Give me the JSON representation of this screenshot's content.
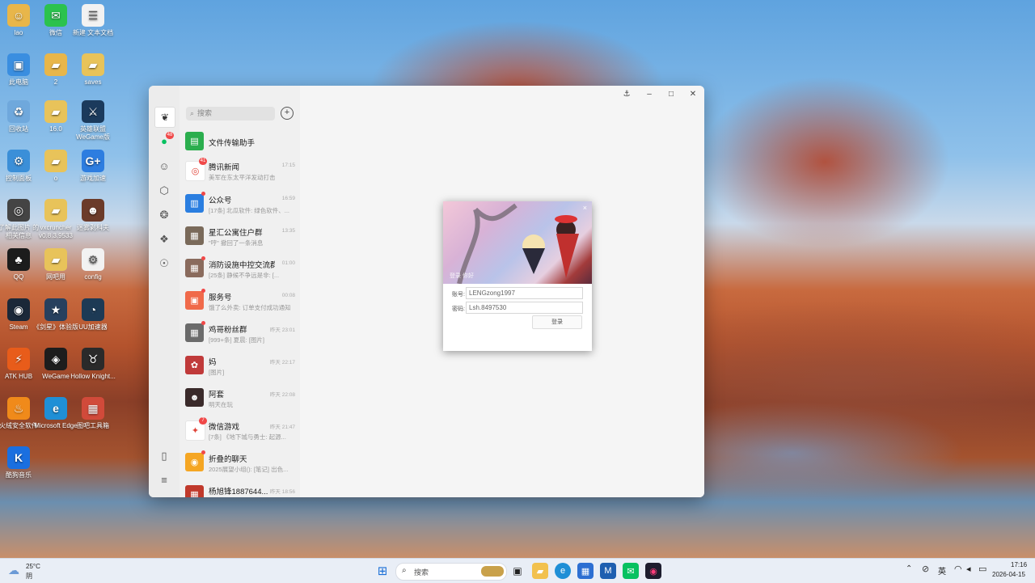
{
  "desktop": {
    "icons": [
      {
        "label": "lao",
        "glyph": "☺",
        "color": "#e8b64a"
      },
      {
        "label": "微信",
        "glyph": "✉",
        "color": "#2bc24e"
      },
      {
        "label": "新建 文本文档",
        "glyph": "☰",
        "color": "#f2f2f2"
      },
      {
        "label": "此电脑",
        "glyph": "▣",
        "color": "#3a8ee0"
      },
      {
        "label": "2",
        "glyph": "▰",
        "color": "#e8b64a"
      },
      {
        "label": "saves",
        "glyph": "▰",
        "color": "#e8c35a"
      },
      {
        "label": "回收站",
        "glyph": "♻",
        "color": "#6fa8dc"
      },
      {
        "label": "16.0",
        "glyph": "▰",
        "color": "#e8c35a"
      },
      {
        "label": "英雄联盟 WeGame版",
        "glyph": "⚔",
        "color": "#1b3a5c"
      },
      {
        "label": "控制面板",
        "glyph": "⚙",
        "color": "#3b8fd8"
      },
      {
        "label": "o",
        "glyph": "▰",
        "color": "#e8c35a"
      },
      {
        "label": "游戏加速",
        "glyph": "G+",
        "color": "#2d7de0"
      },
      {
        "label": "了解此图片 的相关信息",
        "glyph": "◎",
        "color": "#444"
      },
      {
        "label": "vxcruncher v0.8.3.9533",
        "glyph": "▰",
        "color": "#e8c35a"
      },
      {
        "label": "迷雾剥科夫",
        "glyph": "☻",
        "color": "#6b3b2a"
      },
      {
        "label": "QQ",
        "glyph": "♣",
        "color": "#1c1c1c"
      },
      {
        "label": "网吧用",
        "glyph": "▰",
        "color": "#e8c35a"
      },
      {
        "label": "config",
        "glyph": "⚙",
        "color": "#f2f2f2"
      },
      {
        "label": "Steam",
        "glyph": "◉",
        "color": "#1b2838"
      },
      {
        "label": "《剑星》体验版",
        "glyph": "★",
        "color": "#27405e"
      },
      {
        "label": "UU加速器",
        "glyph": "◔",
        "color": "#1d3a55"
      },
      {
        "label": "ATK HUB",
        "glyph": "⚡",
        "color": "#e85c1a"
      },
      {
        "label": "WeGame",
        "glyph": "◈",
        "color": "#1d1d1d"
      },
      {
        "label": "Hollow Knight...",
        "glyph": "♉",
        "color": "#2a2a2a"
      },
      {
        "label": "火绒安全软件",
        "glyph": "♨",
        "color": "#f08a1a"
      },
      {
        "label": "Microsoft Edge",
        "glyph": "e",
        "color": "#1f8fd6"
      },
      {
        "label": "图吧工具箱",
        "glyph": "▦",
        "color": "#d14a3a"
      },
      {
        "label": "酷狗音乐",
        "glyph": "K",
        "color": "#1a6fe0"
      }
    ]
  },
  "wechat": {
    "search_placeholder": "搜索",
    "plus_glyph": "+",
    "sidebar_badge": "48",
    "chats": [
      {
        "name": "文件传输助手",
        "preview": "",
        "time": "",
        "avatar_color": "#2bae4e",
        "glyph": "▤",
        "badge": "",
        "dot": false
      },
      {
        "name": "腾讯新闻",
        "preview": "美军在东太平洋发动打击",
        "time": "17:15",
        "avatar_color": "#ffffff",
        "glyph": "◎",
        "badge": "41",
        "dot": false
      },
      {
        "name": "公众号",
        "preview": "[17条] 北瓜软件: 绿色软件、...",
        "time": "16:59",
        "avatar_color": "#2a7ee0",
        "glyph": "▥",
        "badge": "",
        "dot": true
      },
      {
        "name": "星汇公寓住户群",
        "preview": "\"哼\" 撤回了一条消息",
        "time": "13:35",
        "avatar_color": "#7a6a5a",
        "glyph": "▦",
        "badge": "",
        "dot": false
      },
      {
        "name": "消防设施中控交流群",
        "preview": "[25条] 静候不争远是非: [...",
        "time": "01:00",
        "avatar_color": "#8a6b5d",
        "glyph": "▦",
        "badge": "",
        "dot": true
      },
      {
        "name": "服务号",
        "preview": "饿了么外卖: 订单支付成功通知",
        "time": "00:08",
        "avatar_color": "#f06a4a",
        "glyph": "▣",
        "badge": "",
        "dot": true
      },
      {
        "name": "鸡哥粉丝群",
        "preview": "[999+条] 夏晨: [图片]",
        "time": "昨天 23:01",
        "avatar_color": "#6b6b6b",
        "glyph": "▦",
        "badge": "",
        "dot": true
      },
      {
        "name": "妈",
        "preview": "[图片]",
        "time": "昨天 22:17",
        "avatar_color": "#c03a3a",
        "glyph": "✿",
        "badge": "",
        "dot": false
      },
      {
        "name": "阿套",
        "preview": "明天在玩",
        "time": "昨天 22:08",
        "avatar_color": "#3a2a2a",
        "glyph": "☻",
        "badge": "",
        "dot": false
      },
      {
        "name": "微信游戏",
        "preview": "[7条] 《地下城与勇士: 起源...",
        "time": "昨天 21:47",
        "avatar_color": "#ffffff",
        "glyph": "✦",
        "badge": "7",
        "dot": false
      },
      {
        "name": "折叠的聊天",
        "preview": "2025展望小组(): [笔记] 出色...",
        "time": "",
        "avatar_color": "#f5a623",
        "glyph": "◉",
        "badge": "",
        "dot": true
      },
      {
        "name": "杨旭锋1887644...",
        "preview": "",
        "time": "昨天 18:56",
        "avatar_color": "#c0392b",
        "glyph": "▦",
        "badge": "",
        "dot": false
      }
    ]
  },
  "login_dialog": {
    "banner_caption": "登录  你好",
    "close_glyph": "×",
    "account_label": "账号:",
    "account_value": "LENGzong1997",
    "password_label": "密码:",
    "password_value": "Lsh.8497530",
    "login_label": "登录"
  },
  "taskbar": {
    "weather_temp": "25°C",
    "weather_desc": "阴",
    "search_label": "搜索",
    "ime": "英",
    "time": "17:16",
    "date": "2026-04-15"
  },
  "colors": {
    "wechat_green": "#07c160",
    "badge_red": "#f04848",
    "taskbar_bg": "#e9eef6"
  }
}
